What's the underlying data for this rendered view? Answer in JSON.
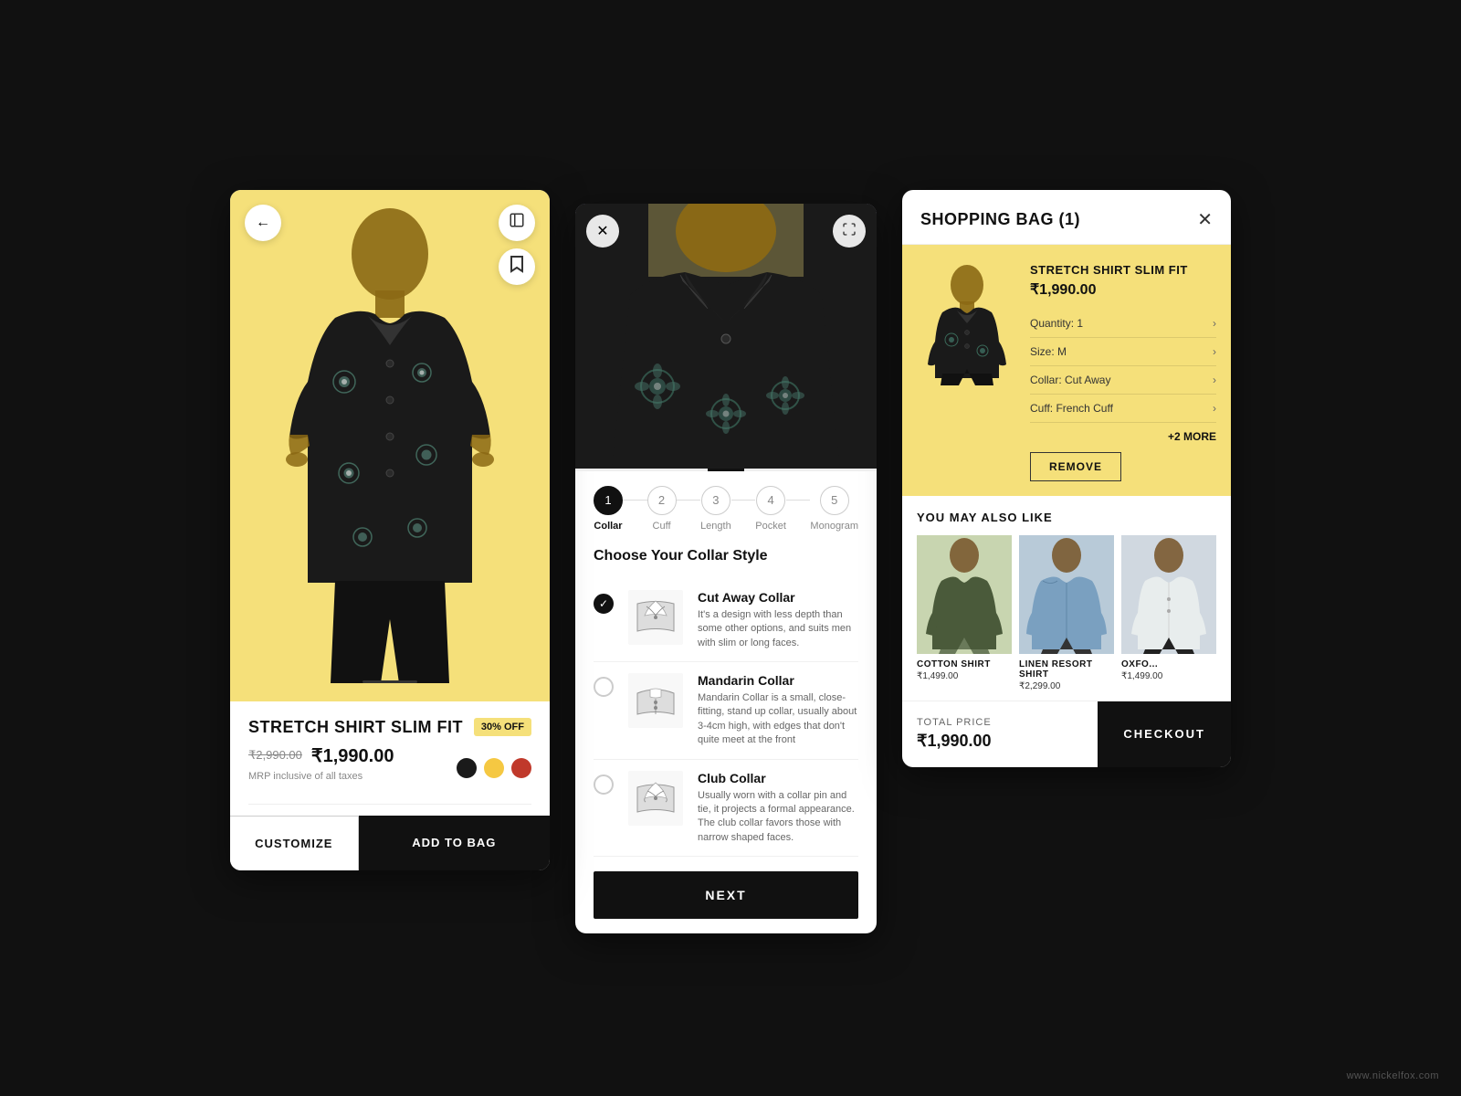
{
  "app": {
    "brand_url": "www.nickelfox.com",
    "bg_color": "#111111"
  },
  "screen1": {
    "product_name": "STRETCH SHIRT SLIM FIT",
    "price_old": "₹2,990.00",
    "price_new": "₹1,990.00",
    "tax_note": "MRP inclusive of all taxes",
    "discount": "30% OFF",
    "colors": [
      "#1a1a1a",
      "#f5c842",
      "#c0392b"
    ],
    "btn_customize": "CUSTOMIZE",
    "btn_add": "ADD TO BAG",
    "back_icon": "←",
    "share_icon": "⊡",
    "bookmark_icon": "🔖"
  },
  "screen2": {
    "close_icon": "✕",
    "expand_icon": "⛶",
    "steps": [
      {
        "number": "1",
        "label": "Collar",
        "active": true
      },
      {
        "number": "2",
        "label": "Cuff",
        "active": false
      },
      {
        "number": "3",
        "label": "Length",
        "active": false
      },
      {
        "number": "4",
        "label": "Pocket",
        "active": false
      },
      {
        "number": "5",
        "label": "Monogram",
        "active": false
      }
    ],
    "section_title": "Choose Your Collar Style",
    "collar_options": [
      {
        "id": "cutaway",
        "name": "Cut Away Collar",
        "desc": "It's a design with less depth than some other options, and suits men with slim or long faces.",
        "selected": true
      },
      {
        "id": "mandarin",
        "name": "Mandarin Collar",
        "desc": "Mandarin Collar is a small, close-fitting, stand up collar, usually about 3-4cm high, with edges that don't quite meet at the front",
        "selected": false
      },
      {
        "id": "club",
        "name": "Club Collar",
        "desc": "Usually worn with a collar pin and tie, it projects a formal appearance. The club collar favors those with narrow shaped face.",
        "selected": false
      }
    ],
    "btn_next": "NEXT"
  },
  "screen3": {
    "title": "SHOPPING BAG (1)",
    "close_icon": "✕",
    "item": {
      "name": "STRETCH SHIRT SLIM FIT",
      "price": "₹1,990.00",
      "quantity": "Quantity: 1",
      "size": "Size: M",
      "collar": "Collar: Cut Away",
      "cuff": "Cuff: French Cuff",
      "more": "+2 MORE",
      "btn_remove": "REMOVE"
    },
    "you_may_like_title": "YOU MAY ALSO LIKE",
    "suggestions": [
      {
        "name": "COTTON SHIRT",
        "price": "₹1,499.00",
        "bg": "#c8d5b0"
      },
      {
        "name": "LINEN RESORT SHIRT",
        "price": "₹2,299.00",
        "bg": "#b8c8d8"
      },
      {
        "name": "OXFORD SHIRT",
        "price": "₹1,499.00",
        "bg": "#d0d8e0"
      }
    ],
    "total_label": "TOTAL PRICE",
    "total_price": "₹1,990.00",
    "btn_checkout": "CHECKOUT"
  }
}
